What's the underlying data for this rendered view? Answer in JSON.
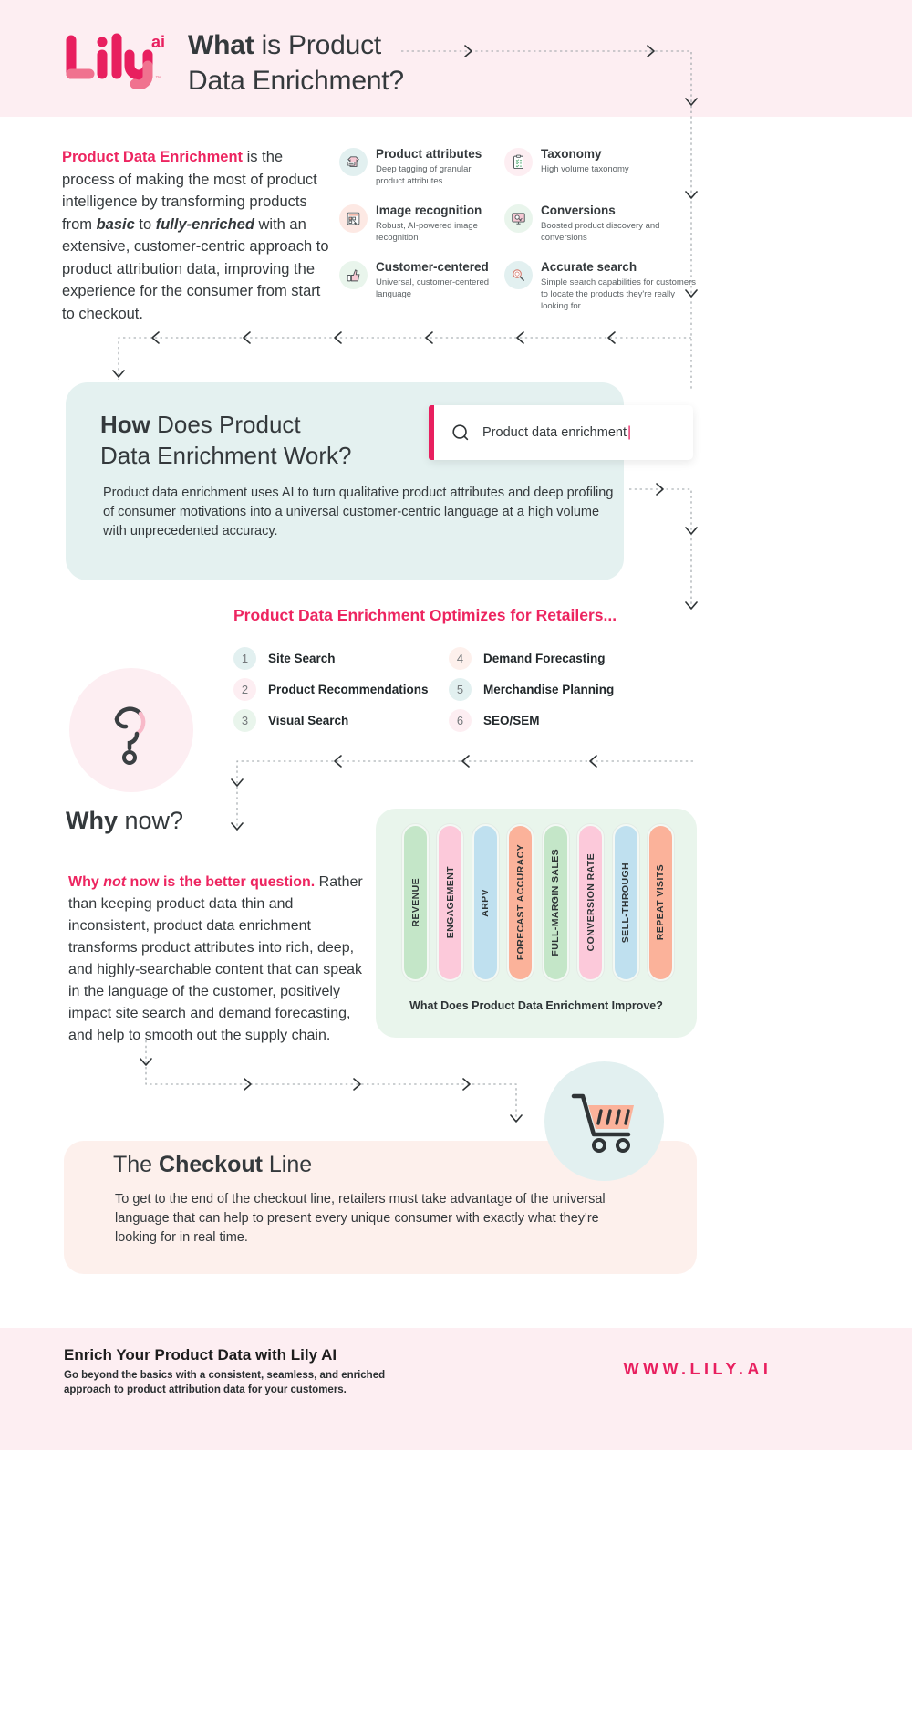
{
  "header": {
    "logo_alt": "Lily ai",
    "logo_main": "Lily",
    "logo_sup": "ai",
    "logo_tm": "™",
    "title_bold": "What",
    "title_rest": " is Product",
    "title_line2": "Data Enrichment?"
  },
  "intro": {
    "highlight": "Product Data Enrichment",
    "p1": " is the process of making the most of product intelligence by transforming products from ",
    "em1": "basic",
    "p2": " to ",
    "em2": "fully-enriched",
    "p3": " with an extensive, customer-centric approach to product attribution data, improving the experience for the consumer from start to checkout."
  },
  "features_left": [
    {
      "icon": "tshirt-tag-icon",
      "title": "Product attributes",
      "desc": "Deep tagging of granular product attributes",
      "bg": "#e2f0f0"
    },
    {
      "icon": "image-grid-icon",
      "title": "Image recognition",
      "desc": "Robust, AI-powered image recognition",
      "bg": "#fde9e4"
    },
    {
      "icon": "thumbs-up-icon",
      "title": "Customer-centered",
      "desc": "Universal, customer-centered language",
      "bg": "#e9f5ec"
    }
  ],
  "features_right": [
    {
      "icon": "clipboard-checklist-icon",
      "title": "Taxonomy",
      "desc": "High volume taxonomy",
      "bg": "#fdeef2"
    },
    {
      "icon": "monitor-cursor-icon",
      "title": "Conversions",
      "desc": "Boosted product discovery and conversions",
      "bg": "#e9f5ec"
    },
    {
      "icon": "magnifier-icon",
      "title": "Accurate search",
      "desc": "Simple search capabilities for customers to locate the products they're really looking for",
      "bg": "#e2f0f0"
    }
  ],
  "how": {
    "title_bold": "How",
    "title_rest": " Does Product",
    "title_line2": "Data Enrichment Work?",
    "body": "Product data enrichment uses AI to turn qualitative product attributes and deep profiling of consumer motivations into a universal customer-centric language at a high volume with unprecedented accuracy.",
    "search_value": "Product data enrichment",
    "search_caret": "|",
    "search_icon": "search-icon"
  },
  "optimizes": {
    "title_pre": "Product Data Enrichment ",
    "title_accent": "Optimizes",
    "title_post": " for Retailers...",
    "column1": [
      {
        "num": "1",
        "label": "Site Search",
        "bg": "#e2f0f0"
      },
      {
        "num": "2",
        "label": "Product Recommendations",
        "bg": "#fdeef2"
      },
      {
        "num": "3",
        "label": "Visual Search",
        "bg": "#e9f5ec"
      }
    ],
    "column2": [
      {
        "num": "4",
        "label": "Demand Forecasting",
        "bg": "#fdf0ec"
      },
      {
        "num": "5",
        "label": "Merchandise Planning",
        "bg": "#e2f0f0"
      },
      {
        "num": "6",
        "label": "SEO/SEM",
        "bg": "#fdeef2"
      }
    ]
  },
  "why": {
    "title_bold": "Why",
    "title_rest": " now?",
    "lead_a": "Why ",
    "lead_em": "not",
    "lead_b": " now is the better question.",
    "body": "Rather than keeping product data thin and inconsistent, product data enrichment transforms product attributes into rich, deep, and highly-searchable content that can speak in the language of the customer, positively impact site search and demand forecasting, and help to smooth out the supply chain.",
    "question_icon": "question-mark-icon"
  },
  "chart_data": {
    "type": "bar",
    "title": "What Does Product Data Enrichment Improve?",
    "categories": [
      "REVENUE",
      "ENGAGEMENT",
      "ARPV",
      "FORECAST ACCURACY",
      "FULL-MARGIN SALES",
      "CONVERSION RATE",
      "SELL-THROUGH",
      "REPEAT VISITS"
    ],
    "values": [
      100,
      100,
      100,
      100,
      100,
      100,
      100,
      100
    ],
    "colors": [
      "#c4e6c8",
      "#fcc9da",
      "#bfe0ef",
      "#fbb29a",
      "#c4e6c8",
      "#fcc9da",
      "#bfe0ef",
      "#fbb29a"
    ],
    "xlabel": "",
    "ylabel": "",
    "ylim": [
      0,
      100
    ],
    "grid": false,
    "legend": "none"
  },
  "checkout": {
    "title_pre": "The ",
    "title_bold": "Checkout",
    "title_post": " Line",
    "body": "To get to the end of the checkout line, retailers must take advantage of the universal language that can help to present every unique consumer with exactly what they're looking for in real time.",
    "cart_icon": "shopping-cart-icon"
  },
  "footer": {
    "title": "Enrich Your Product Data with Lily AI",
    "subtitle": "Go beyond the basics with a consistent, seamless, and enriched approach to product attribution data for your customers.",
    "url": "WWW.LILY.AI"
  },
  "colors": {
    "brand_pink": "#ed2560",
    "mint": "#e4f1f0",
    "blush": "#fdeef2",
    "green": "#e9f5ec",
    "peach": "#fdf0ec",
    "ink": "#34393c"
  }
}
